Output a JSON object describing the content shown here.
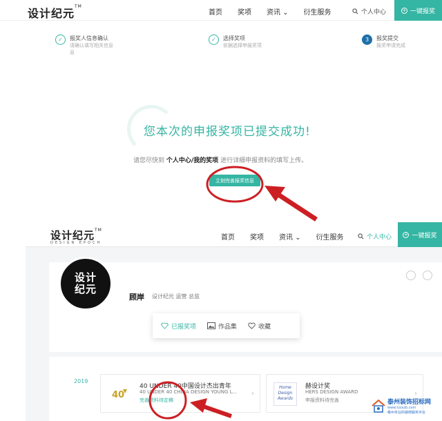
{
  "top_nav": {
    "logo": "设计纪元",
    "logo_tm": "TM",
    "links": [
      "首页",
      "奖项",
      "资讯 ⌄",
      "衍生服务"
    ],
    "search_label": "个人中心",
    "report_label": "一键报奖"
  },
  "steps": [
    {
      "num": "✓",
      "title": "报奖人信息确认",
      "desc": "请确认填写相关信息",
      "desc2": "息"
    },
    {
      "num": "✓",
      "title": "选择奖项",
      "desc": "依据选择申报奖项"
    },
    {
      "num": "3",
      "title": "报奖提交",
      "desc": "报奖申请完成"
    }
  ],
  "success": {
    "title": "您本次的申报奖项已提交成功!",
    "hint_prefix": "请您尽快到",
    "hint_link": "个人中心/我的奖项",
    "hint_suffix": "进行详细申报资料的填写上传。",
    "button": "立刻完善报奖信息"
  },
  "bottom_nav": {
    "logo": "设计纪元",
    "logo_tm": "TM",
    "sublogo": "DESIGN EPOCH",
    "links": [
      "首页",
      "奖项",
      "资讯 ⌄",
      "衍生服务"
    ],
    "search_label": "个人中心",
    "report_label": "一键报奖"
  },
  "profile": {
    "avatar_line1": "设计",
    "avatar_line2": "纪元",
    "name": "顾岸",
    "title": "设计纪元 运营 总监",
    "tabs": [
      {
        "label": "已报奖项",
        "icon": "diamond-icon"
      },
      {
        "label": "作品集",
        "icon": "image-icon"
      },
      {
        "label": "收藏",
        "icon": "heart-icon"
      }
    ]
  },
  "awards": {
    "year": "2019",
    "items": [
      {
        "name": "40 UNDER 40中国设计杰出青年",
        "ename": "40 UNDER 40 CHINA DESIGN YOUNG L...",
        "status": "完善资料待定稿"
      },
      {
        "name": "赫设计奖",
        "ename": "HERS DESIGN AWARD",
        "status": "申报资料待完善",
        "thumb_line1": "Home",
        "thumb_line2": "Design",
        "thumb_line3": "Awards"
      }
    ]
  },
  "watermark": {
    "line1": "泰州装饰招标网",
    "line2": "泰州专业的装修服务平台",
    "url": "www.tzzszb.com"
  },
  "colors": {
    "accent": "#35b5a3",
    "annotation": "#cc1f24"
  }
}
